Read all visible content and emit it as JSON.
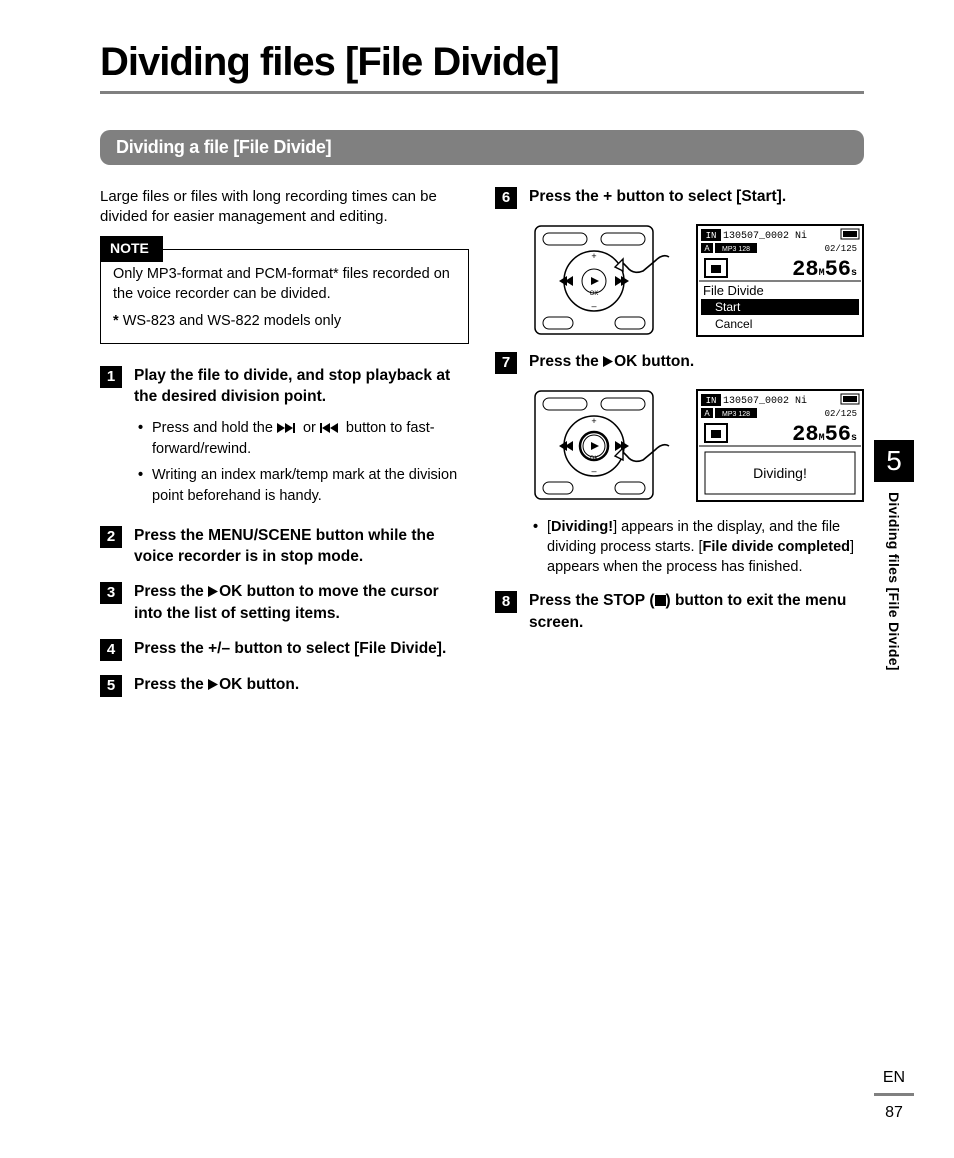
{
  "page_title": "Dividing files [File Divide]",
  "section_heading": "Dividing a file [File Divide]",
  "intro": "Large files or files with long recording times can be divided for easier management and editing.",
  "note": {
    "label": "NOTE",
    "body": "Only MP3-format and PCM-format* files recorded on the voice recorder can be divided.",
    "footnote_marker": "*",
    "footnote": "WS-823 and WS-822 models only"
  },
  "steps": {
    "s1": {
      "num": "1",
      "head_a": "Play the file to divide, and stop playback at the desired division point.",
      "bullet1_a": "Press and hold the ",
      "bullet1_b": " or ",
      "bullet1_c": " button to fast-forward/rewind.",
      "bullet2": "Writing an index mark/temp mark at the division point beforehand is handy."
    },
    "s2": {
      "num": "2",
      "head_a": "Press the ",
      "head_b": "MENU/SCENE",
      "head_c": " button while the voice recorder is in stop mode."
    },
    "s3": {
      "num": "3",
      "head_a": "Press the ",
      "head_ok": "OK",
      "head_b": " button to move the cursor into the list of setting items."
    },
    "s4": {
      "num": "4",
      "head_a": "Press the ",
      "head_pm": "+/–",
      "head_b": " button to select [",
      "head_fd": "File Divide",
      "head_c": "]."
    },
    "s5": {
      "num": "5",
      "head_a": "Press the ",
      "head_ok": "OK",
      "head_b": " button."
    },
    "s6": {
      "num": "6",
      "head_a": "Press the ",
      "head_plus": "+",
      "head_b": " button to select [",
      "head_start": "Start",
      "head_c": "]."
    },
    "s7": {
      "num": "7",
      "head_a": "Press the ",
      "head_ok": "OK",
      "head_b": " button.",
      "bullet_a": "[",
      "bullet_div": "Dividing!",
      "bullet_b": "] appears in the display, and the file dividing process starts. [",
      "bullet_done": "File divide completed",
      "bullet_c": "] appears when the process has finished."
    },
    "s8": {
      "num": "8",
      "head_a": "Press the ",
      "head_stop": "STOP",
      "head_b": " (",
      "head_c": ") button to exit the menu screen."
    }
  },
  "lcd": {
    "top": "130507_0002 Ni",
    "mode": "MP3 128",
    "count": "02/125",
    "time_m": "28",
    "time_m_unit": "M",
    "time_s": "56",
    "time_s_unit": "s",
    "menu_title": "File Divide",
    "menu_start": "Start",
    "menu_cancel": "Cancel",
    "dividing": "Dividing!"
  },
  "side": {
    "chapter": "5",
    "label": "Dividing files [File Divide]"
  },
  "footer": {
    "lang": "EN",
    "page": "87"
  }
}
